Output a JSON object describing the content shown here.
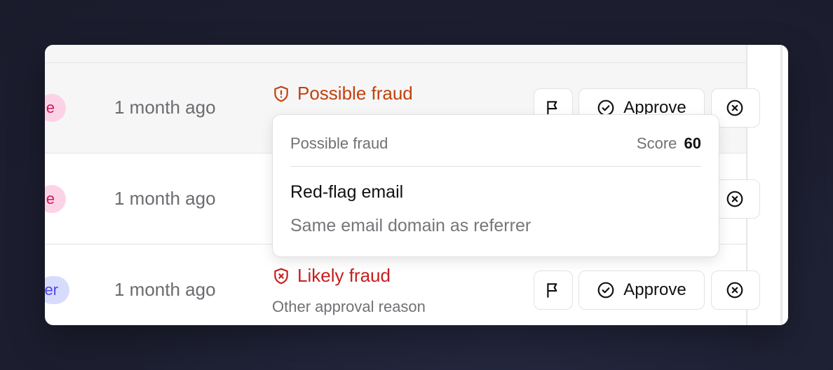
{
  "rows": [
    {
      "badge": "e",
      "time": "1 month ago",
      "status": "Possible fraud",
      "reason": "",
      "approve_label": "Approve"
    },
    {
      "badge": "e",
      "time": "1 month ago",
      "status": "",
      "reason": "",
      "approve_label": ""
    },
    {
      "badge": "er",
      "time": "1 month ago",
      "status": "Likely fraud",
      "reason": "Other approval reason",
      "approve_label": "Approve"
    }
  ],
  "tooltip": {
    "heading": "Possible fraud",
    "score_label": "Score",
    "score_value": "60",
    "title": "Red-flag email",
    "description": "Same email domain as referrer"
  },
  "colors": {
    "possible_fraud": "#c2410c",
    "likely_fraud": "#c81e1e",
    "badge_pink_bg": "#fcd3e6",
    "badge_pink_text": "#d0185c",
    "badge_blue_bg": "#d7dcfd",
    "badge_blue_text": "#4f46e5"
  },
  "icons": {
    "possible_fraud": "shield-exclamation-icon",
    "likely_fraud": "shield-x-icon",
    "flag": "flag-icon",
    "approve": "check-circle-icon",
    "reject": "x-circle-icon"
  }
}
